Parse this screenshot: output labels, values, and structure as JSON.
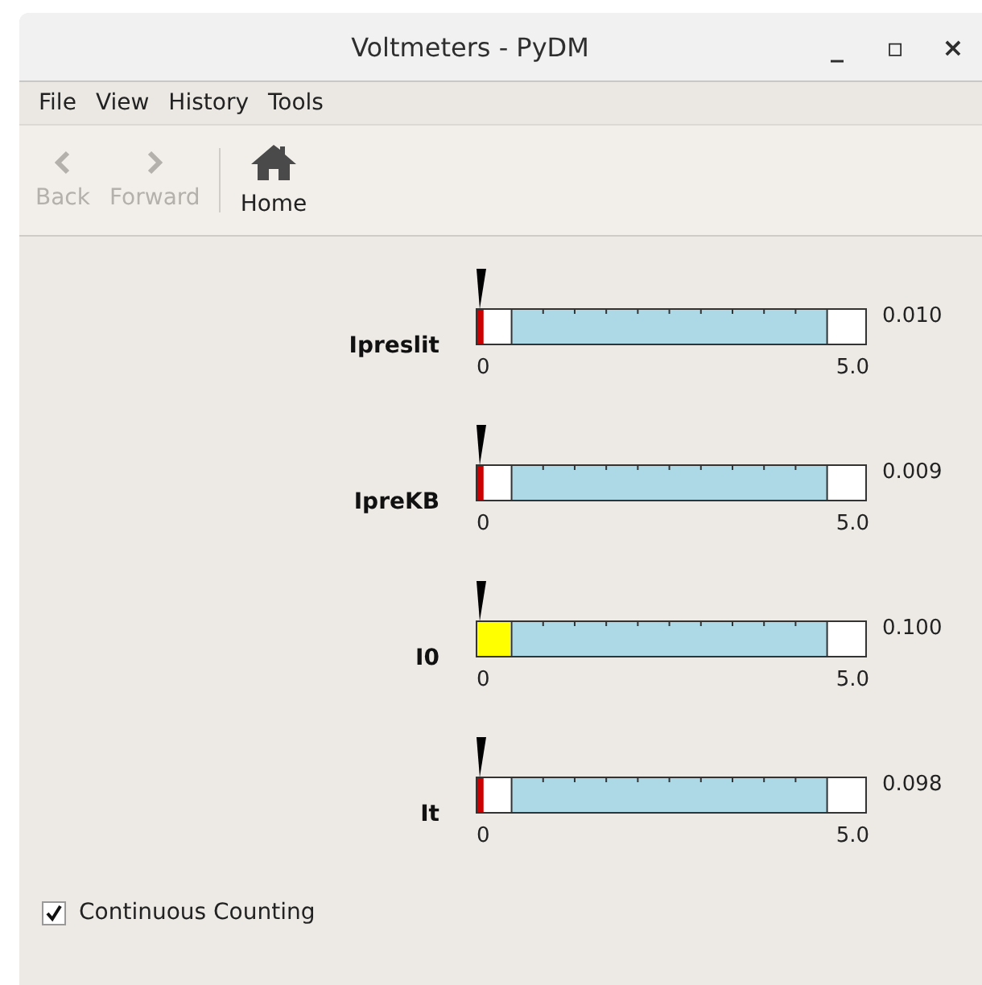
{
  "window": {
    "title": "Voltmeters - PyDM",
    "controls": [
      "_",
      "▫",
      "×"
    ]
  },
  "menu": [
    "File",
    "View",
    "History",
    "Tools"
  ],
  "toolbar": [
    {
      "kind": "back",
      "label": "Back",
      "disabled": true
    },
    {
      "kind": "forward",
      "label": "Forward",
      "disabled": true
    },
    {
      "kind": "home",
      "label": "Home",
      "disabled": false
    }
  ],
  "meters": [
    {
      "name": "Ipreslit",
      "reading": "0.010",
      "min": "0",
      "max": "5.0",
      "level": 0.016,
      "color": "#cc0000"
    },
    {
      "name": "IpreKB",
      "reading": "0.009",
      "min": "0",
      "max": "5.0",
      "level": 0.016,
      "color": "#cc0000"
    },
    {
      "name": "I0",
      "reading": "0.100",
      "min": "0",
      "max": "5.0",
      "level": 0.085,
      "color": "#ffff00"
    },
    {
      "name": "It",
      "reading": "0.098",
      "min": "0",
      "max": "5.0",
      "level": 0.016,
      "color": "#cc0000"
    }
  ],
  "continuous_counting": {
    "label": "Continuous Counting",
    "checked": true
  }
}
